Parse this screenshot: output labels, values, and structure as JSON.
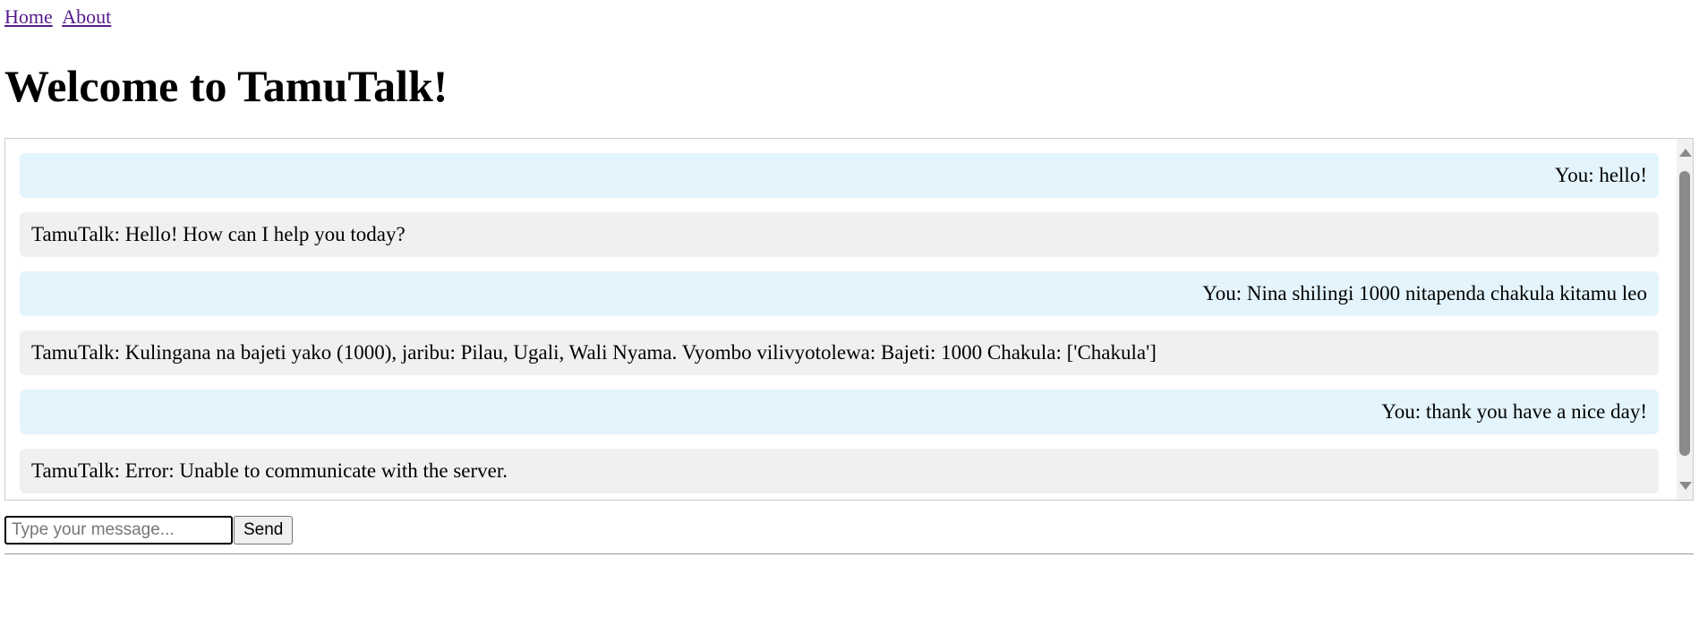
{
  "nav": {
    "home_label": "Home",
    "about_label": "About"
  },
  "page": {
    "title": "Welcome to TamuTalk!"
  },
  "chat": {
    "messages": [
      {
        "sender": "user",
        "text": "You: hello!"
      },
      {
        "sender": "bot",
        "text": "TamuTalk: Hello! How can I help you today?"
      },
      {
        "sender": "user",
        "text": "You: Nina shilingi 1000 nitapenda chakula kitamu leo"
      },
      {
        "sender": "bot",
        "text": "TamuTalk: Kulingana na bajeti yako (1000), jaribu: Pilau, Ugali, Wali Nyama. Vyombo vilivyotolewa: Bajeti: 1000 Chakula: ['Chakula']"
      },
      {
        "sender": "user",
        "text": "You: thank you have a nice day!"
      },
      {
        "sender": "bot",
        "text": "TamuTalk: Error: Unable to communicate with the server."
      }
    ]
  },
  "composer": {
    "input_value": "",
    "input_placeholder": "Type your message...",
    "send_label": "Send"
  },
  "colors": {
    "user_bubble": "#e3f4fc",
    "bot_bubble": "#f0f0f0",
    "link": "#551a8b"
  }
}
